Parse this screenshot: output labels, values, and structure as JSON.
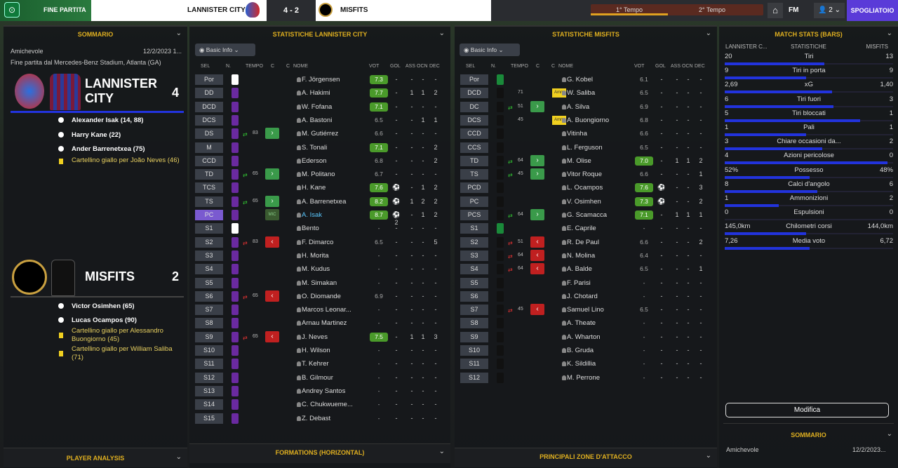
{
  "header": {
    "status": "FINE PARTITA",
    "home": "LANNISTER CITY",
    "score": "4 - 2",
    "away": "MISFITS",
    "first_half": "1° Tempo",
    "second_half": "2° Tempo",
    "fm": "FM",
    "users": "2",
    "button": "SPOGLIATOIO"
  },
  "summary": {
    "title": "SOMMARIO",
    "comp": "Amichevole",
    "date": "12/2/2023 1...",
    "venue": "Fine partita dal Mercedes-Benz Stadium, Atlanta (GA)",
    "home_name": "LANNISTER CITY",
    "home_score": "4",
    "away_name": "MISFITS",
    "away_score": "2",
    "home_events": [
      {
        "t": "goal",
        "text": "Alexander Isak (14, 88)"
      },
      {
        "t": "goal",
        "text": "Harry Kane (22)"
      },
      {
        "t": "goal",
        "text": "Ander Barrenetxea (75)"
      },
      {
        "t": "yellow",
        "text": "Cartellino giallo per João Neves (46)"
      }
    ],
    "away_events": [
      {
        "t": "goal",
        "text": "Victor Osimhen (65)"
      },
      {
        "t": "goal",
        "text": "Lucas Ocampos (90)"
      },
      {
        "t": "yellow",
        "text": "Cartellino giallo per Alessandro Buongiorno (45)"
      },
      {
        "t": "yellow",
        "text": "Cartellino giallo per William Saliba (71)"
      }
    ],
    "footer": "PLAYER ANALYSIS"
  },
  "home_stats": {
    "title": "STATISTICHE LANNISTER CITY",
    "dropdown": "Basic Info",
    "footer": "FORMATIONS (HORIZONTAL)",
    "cols": [
      "SEL",
      "N.",
      "TEMPO",
      "C",
      "C",
      "NOME",
      "VOT",
      "GOL",
      "ASS",
      "OCN",
      "DEC"
    ],
    "rows": [
      {
        "pos": "Por",
        "name": "F. Jörgensen",
        "vot": "7.3",
        "g": true,
        "gol": "-",
        "ass": "-",
        "ocn": "-",
        "dec": "-",
        "col": "#fff"
      },
      {
        "pos": "DD",
        "name": "A. Hakimi",
        "vot": "7.7",
        "g": true,
        "gol": "-",
        "ass": "1",
        "ocn": "1",
        "dec": "2"
      },
      {
        "pos": "DCD",
        "name": "W. Fofana",
        "vot": "7.1",
        "g": true,
        "gol": "-",
        "ass": "-",
        "ocn": "-",
        "dec": "-"
      },
      {
        "pos": "DCS",
        "name": "A. Bastoni",
        "vot": "6.5",
        "gol": "-",
        "ass": "-",
        "ocn": "1",
        "dec": "1"
      },
      {
        "pos": "DS",
        "name": "M. Gutiérrez",
        "vot": "6.6",
        "gol": "-",
        "ass": "-",
        "ocn": "-",
        "dec": "-",
        "tin": "83",
        "sub": "in"
      },
      {
        "pos": "M",
        "name": "S. Tonali",
        "vot": "7.1",
        "g": true,
        "gol": "-",
        "ass": "-",
        "ocn": "-",
        "dec": "2"
      },
      {
        "pos": "CCD",
        "name": "Ederson",
        "vot": "6.8",
        "gol": "-",
        "ass": "-",
        "ocn": "-",
        "dec": "2"
      },
      {
        "pos": "TD",
        "name": "M. Politano",
        "vot": "6.7",
        "gol": "-",
        "ass": "-",
        "ocn": "-",
        "dec": "-",
        "tin": "65",
        "sub": "in"
      },
      {
        "pos": "TCS",
        "name": "H. Kane",
        "vot": "7.6",
        "g": true,
        "gol": "⚽",
        "ass": "-",
        "ocn": "1",
        "dec": "2"
      },
      {
        "pos": "TS",
        "name": "A. Barrenetxea",
        "vot": "8.2",
        "g": true,
        "gol": "⚽",
        "ass": "1",
        "ocn": "2",
        "dec": "2",
        "tin": "65",
        "sub": "in"
      },
      {
        "pos": "PC",
        "name": "A. Isak",
        "vot": "8.7",
        "g": true,
        "gol": "⚽2",
        "ass": "-",
        "ocn": "1",
        "dec": "2",
        "sub": "mic",
        "hl": true
      },
      {
        "pos": "S1",
        "name": "Bento",
        "vot": "-",
        "gol": "-",
        "ass": "-",
        "ocn": "-",
        "dec": "-",
        "col": "#fff"
      },
      {
        "pos": "S2",
        "name": "F. Dimarco",
        "vot": "6.5",
        "gol": "-",
        "ass": "-",
        "ocn": "-",
        "dec": "5",
        "tout": "83",
        "sub": "out"
      },
      {
        "pos": "S3",
        "name": "H. Morita",
        "vot": "-",
        "gol": "-",
        "ass": "-",
        "ocn": "-",
        "dec": "-"
      },
      {
        "pos": "S4",
        "name": "M. Kudus",
        "vot": "-",
        "gol": "-",
        "ass": "-",
        "ocn": "-",
        "dec": "-"
      },
      {
        "pos": "S5",
        "name": "M. Simakan",
        "vot": "-",
        "gol": "-",
        "ass": "-",
        "ocn": "-",
        "dec": "-"
      },
      {
        "pos": "S6",
        "name": "O. Diomande",
        "vot": "6.9",
        "gol": "-",
        "ass": "-",
        "ocn": "-",
        "dec": "-",
        "tout": "65",
        "sub": "out"
      },
      {
        "pos": "S7",
        "name": "Marcos Leonar...",
        "vot": "-",
        "gol": "-",
        "ass": "-",
        "ocn": "-",
        "dec": "-"
      },
      {
        "pos": "S8",
        "name": "Arnau Martinez",
        "vot": "-",
        "gol": "-",
        "ass": "-",
        "ocn": "-",
        "dec": "-"
      },
      {
        "pos": "S9",
        "name": "J. Neves",
        "vot": "7.5",
        "g": true,
        "gol": "-",
        "ass": "1",
        "ocn": "1",
        "dec": "3",
        "tout": "65",
        "sub": "out"
      },
      {
        "pos": "S10",
        "name": "H. Wilson",
        "vot": "-",
        "gol": "-",
        "ass": "-",
        "ocn": "-",
        "dec": "-"
      },
      {
        "pos": "S11",
        "name": "T. Kehrer",
        "vot": "-",
        "gol": "-",
        "ass": "-",
        "ocn": "-",
        "dec": "-"
      },
      {
        "pos": "S12",
        "name": "B. Gilmour",
        "vot": "-",
        "gol": "-",
        "ass": "-",
        "ocn": "-",
        "dec": "-"
      },
      {
        "pos": "S13",
        "name": "Andrey Santos",
        "vot": "-",
        "gol": "-",
        "ass": "-",
        "ocn": "-",
        "dec": "-"
      },
      {
        "pos": "S14",
        "name": "C. Chukwueme...",
        "vot": "-",
        "gol": "-",
        "ass": "-",
        "ocn": "-",
        "dec": "-"
      },
      {
        "pos": "S15",
        "name": "Z. Debast",
        "vot": "-",
        "gol": "-",
        "ass": "-",
        "ocn": "-",
        "dec": "-"
      }
    ]
  },
  "away_stats": {
    "title": "STATISTICHE MISFITS",
    "dropdown": "Basic Info",
    "footer": "PRINCIPALI ZONE D'ATTACCO",
    "cols": [
      "SEL",
      "N.",
      "TEMPO",
      "C",
      "C",
      "NOME",
      "VOT",
      "GOL",
      "ASS",
      "OCN",
      "DEC"
    ],
    "rows": [
      {
        "pos": "Por",
        "name": "G. Kobel",
        "vot": "6.1",
        "gol": "-",
        "ass": "-",
        "ocn": "-",
        "dec": "-",
        "col": "#1a8a3a"
      },
      {
        "pos": "DCD",
        "name": "W. Saliba",
        "vot": "6.5",
        "gol": "-",
        "ass": "-",
        "ocn": "-",
        "dec": "-",
        "tout": "71",
        "card": "Amm"
      },
      {
        "pos": "DC",
        "name": "A. Silva",
        "vot": "6.9",
        "gol": "-",
        "ass": "-",
        "ocn": "-",
        "dec": "-",
        "tin": "51",
        "sub": "in"
      },
      {
        "pos": "DCS",
        "name": "A. Buongiorno",
        "vot": "6.8",
        "gol": "-",
        "ass": "-",
        "ocn": "-",
        "dec": "-",
        "tout": "45",
        "card": "Amm"
      },
      {
        "pos": "CCD",
        "name": "Vitinha",
        "vot": "6.6",
        "gol": "-",
        "ass": "-",
        "ocn": "-",
        "dec": "-"
      },
      {
        "pos": "CCS",
        "name": "L. Ferguson",
        "vot": "6.5",
        "gol": "-",
        "ass": "-",
        "ocn": "-",
        "dec": "-"
      },
      {
        "pos": "TD",
        "name": "M. Olise",
        "vot": "7.0",
        "g": true,
        "gol": "-",
        "ass": "1",
        "ocn": "1",
        "dec": "2",
        "tin": "64",
        "sub": "in"
      },
      {
        "pos": "TS",
        "name": "Vitor Roque",
        "vot": "6.6",
        "gol": "-",
        "ass": "-",
        "ocn": "-",
        "dec": "1",
        "tin": "45",
        "sub": "in"
      },
      {
        "pos": "PCD",
        "name": "L. Ocampos",
        "vot": "7.6",
        "g": true,
        "gol": "⚽",
        "ass": "-",
        "ocn": "-",
        "dec": "3"
      },
      {
        "pos": "PC",
        "name": "V. Osimhen",
        "vot": "7.3",
        "g": true,
        "gol": "⚽",
        "ass": "-",
        "ocn": "-",
        "dec": "2"
      },
      {
        "pos": "PCS",
        "name": "G. Scamacca",
        "vot": "7.1",
        "g": true,
        "gol": "-",
        "ass": "1",
        "ocn": "1",
        "dec": "1",
        "tin": "64",
        "sub": "in"
      },
      {
        "pos": "S1",
        "name": "E. Caprile",
        "vot": "-",
        "gol": "-",
        "ass": "-",
        "ocn": "-",
        "dec": "-",
        "col": "#1a8a3a"
      },
      {
        "pos": "S2",
        "name": "R. De Paul",
        "vot": "6.6",
        "gol": "-",
        "ass": "-",
        "ocn": "-",
        "dec": "2",
        "tout": "51",
        "sub": "out"
      },
      {
        "pos": "S3",
        "name": "N. Molina",
        "vot": "6.4",
        "gol": "-",
        "ass": "-",
        "ocn": "-",
        "dec": "-",
        "tout": "64",
        "sub": "out"
      },
      {
        "pos": "S4",
        "name": "A. Balde",
        "vot": "6.5",
        "gol": "-",
        "ass": "-",
        "ocn": "-",
        "dec": "1",
        "tout": "64",
        "sub": "out"
      },
      {
        "pos": "S5",
        "name": "F. Parisi",
        "vot": "-",
        "gol": "-",
        "ass": "-",
        "ocn": "-",
        "dec": "-"
      },
      {
        "pos": "S6",
        "name": "J. Chotard",
        "vot": "-",
        "gol": "-",
        "ass": "-",
        "ocn": "-",
        "dec": "-"
      },
      {
        "pos": "S7",
        "name": "Samuel Lino",
        "vot": "6.5",
        "gol": "-",
        "ass": "-",
        "ocn": "-",
        "dec": "-",
        "tout": "45",
        "sub": "out"
      },
      {
        "pos": "S8",
        "name": "A. Theate",
        "vot": "-",
        "gol": "-",
        "ass": "-",
        "ocn": "-",
        "dec": "-"
      },
      {
        "pos": "S9",
        "name": "A. Wharton",
        "vot": "-",
        "gol": "-",
        "ass": "-",
        "ocn": "-",
        "dec": "-"
      },
      {
        "pos": "S10",
        "name": "B. Gruda",
        "vot": "-",
        "gol": "-",
        "ass": "-",
        "ocn": "-",
        "dec": "-"
      },
      {
        "pos": "S11",
        "name": "K. Sildillia",
        "vot": "-",
        "gol": "-",
        "ass": "-",
        "ocn": "-",
        "dec": "-"
      },
      {
        "pos": "S12",
        "name": "M. Perrone",
        "vot": "-",
        "gol": "-",
        "ass": "-",
        "ocn": "-",
        "dec": "-"
      }
    ]
  },
  "match_stats": {
    "title": "MATCH STATS (BARS)",
    "col_home": "LANNISTER C...",
    "col_mid": "STATISTICHE",
    "col_away": "MISFITS",
    "rows": [
      {
        "label": "Tiri",
        "h": "20",
        "a": "13",
        "frac": 0.61
      },
      {
        "label": "Tiri in porta",
        "h": "9",
        "a": "9",
        "frac": 0.5
      },
      {
        "label": "xG",
        "h": "2,69",
        "a": "1,40",
        "frac": 0.66
      },
      {
        "label": "Tiri fuori",
        "h": "6",
        "a": "3",
        "frac": 0.67
      },
      {
        "label": "Tiri bloccati",
        "h": "5",
        "a": "1",
        "frac": 0.83
      },
      {
        "label": "Pali",
        "h": "1",
        "a": "1",
        "frac": 0.5
      },
      {
        "label": "Chiare occasioni da...",
        "h": "3",
        "a": "2",
        "frac": 0.6
      },
      {
        "label": "Azioni pericolose",
        "h": "4",
        "a": "0",
        "frac": 1.0
      },
      {
        "label": "Possesso",
        "h": "52%",
        "a": "48%",
        "frac": 0.52
      },
      {
        "label": "Calci d'angolo",
        "h": "8",
        "a": "6",
        "frac": 0.57
      },
      {
        "label": "Ammonizioni",
        "h": "1",
        "a": "2",
        "frac": 0.33
      },
      {
        "label": "Espulsioni",
        "h": "0",
        "a": "0",
        "frac": 0.0
      },
      {
        "label": "Chilometri corsi",
        "h": "145,0km",
        "a": "144,0km",
        "frac": 0.5
      },
      {
        "label": "Media voto",
        "h": "7,26",
        "a": "6,72",
        "frac": 0.52
      }
    ],
    "button": "Modifica",
    "summary_title": "SOMMARIO",
    "summary_comp": "Amichevole",
    "summary_date": "12/2/2023..."
  },
  "colors": {
    "accent": "#e0b020",
    "bar": "#2233dd",
    "home_shirt": "#6a2aa0",
    "away_shirt": "#111111"
  }
}
